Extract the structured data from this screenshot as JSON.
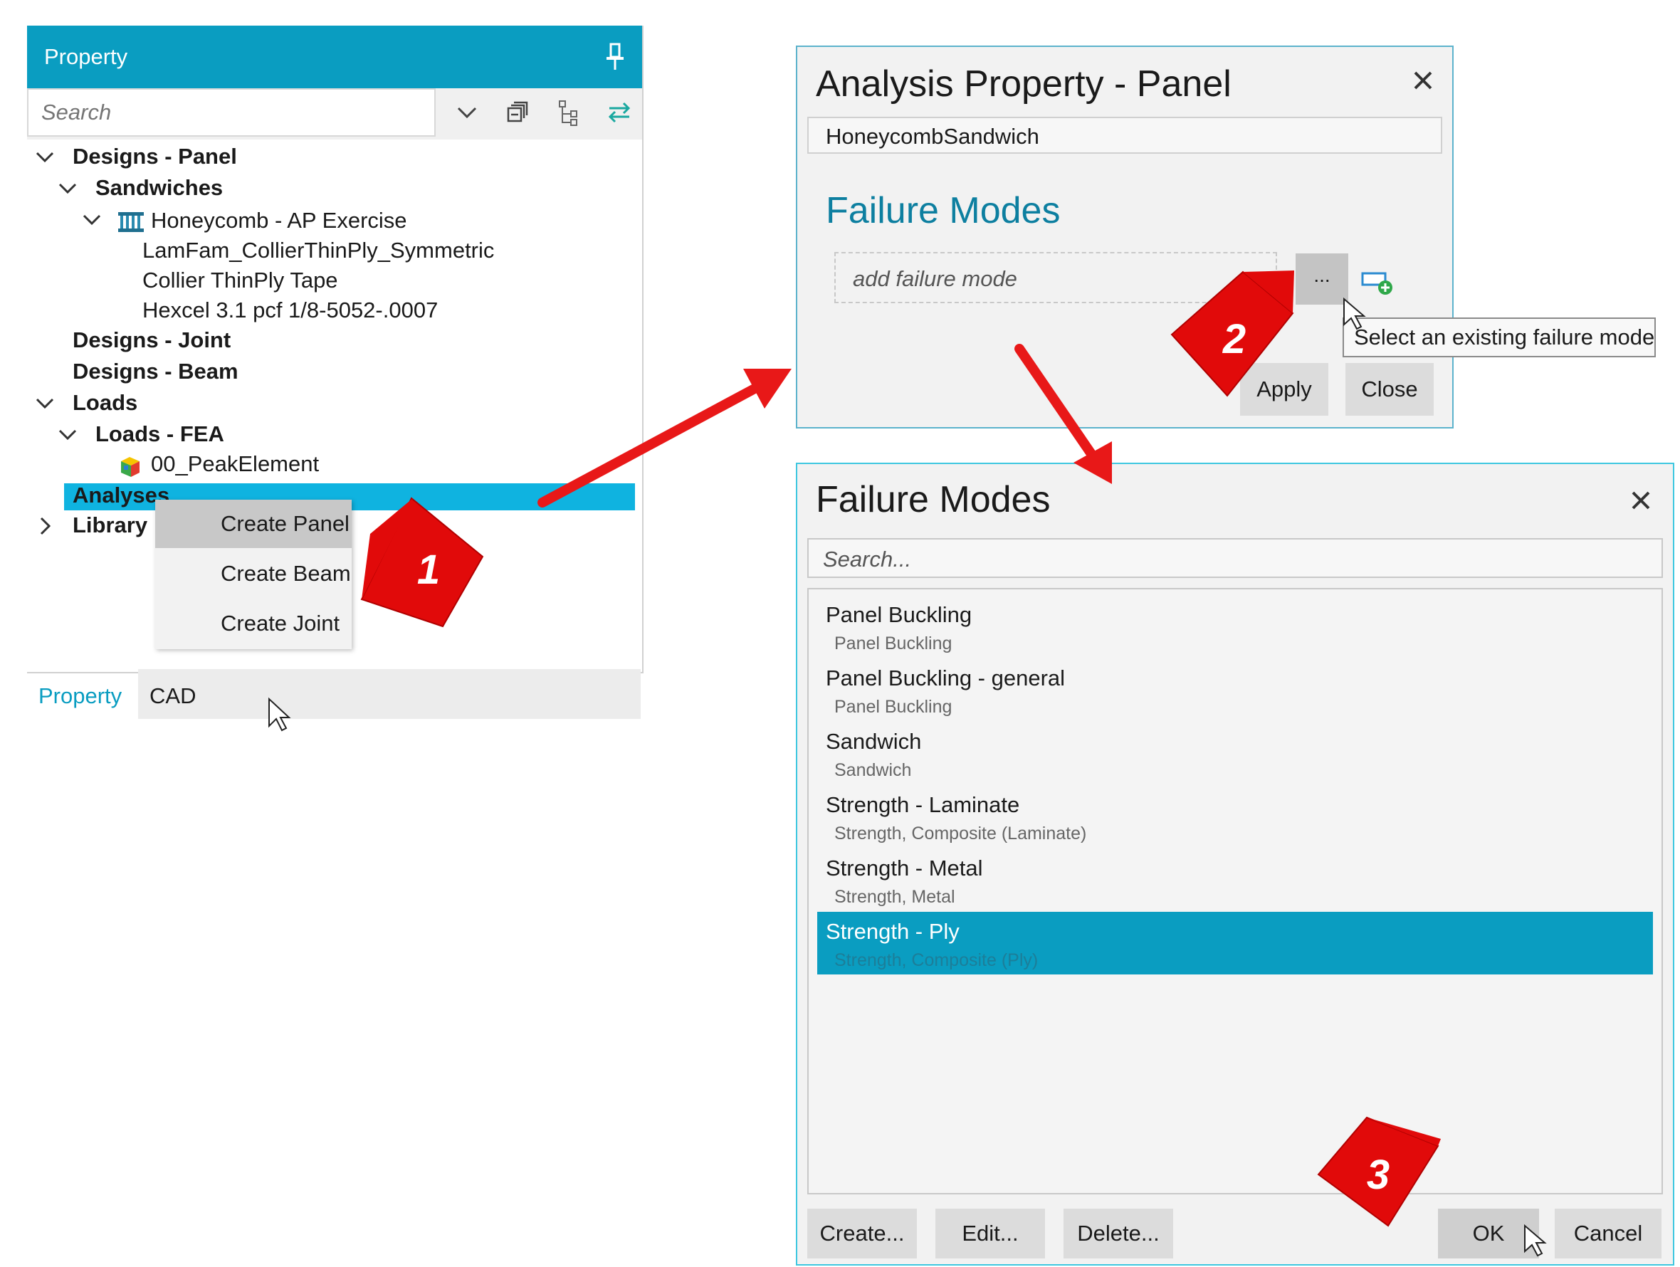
{
  "property_panel": {
    "title": "Property",
    "search_placeholder": "Search",
    "tree": [
      {
        "label": "Designs - Panel"
      },
      {
        "label": "Sandwiches"
      },
      {
        "label": "Honeycomb - AP Exercise"
      },
      {
        "label": "LamFam_CollierThinPly_Symmetric"
      },
      {
        "label": "Collier ThinPly Tape"
      },
      {
        "label": "Hexcel 3.1 pcf 1/8-5052-.0007"
      },
      {
        "label": "Designs - Joint"
      },
      {
        "label": "Designs - Beam"
      },
      {
        "label": "Loads"
      },
      {
        "label": "Loads - FEA"
      },
      {
        "label": "00_PeakElement"
      },
      {
        "label": "Analyses"
      },
      {
        "label": "Library"
      }
    ],
    "context_menu": [
      "Create Panel",
      "Create Beam",
      "Create Joint"
    ],
    "tabs": {
      "property": "Property",
      "cad": "CAD"
    }
  },
  "analysis_dialog": {
    "title": "Analysis Property - Panel",
    "name_value": "HoneycombSandwich",
    "section_heading": "Failure Modes",
    "failure_mode_placeholder": "add failure mode",
    "ellipsis_label": "...",
    "tooltip": "Select an existing failure mode",
    "apply_label": "Apply",
    "close_label": "Close"
  },
  "failure_modes_dialog": {
    "title": "Failure Modes",
    "search_placeholder": "Search...",
    "items": [
      {
        "name": "Panel Buckling",
        "desc": "Panel Buckling"
      },
      {
        "name": "Panel Buckling - general",
        "desc": "Panel Buckling"
      },
      {
        "name": "Sandwich",
        "desc": "Sandwich"
      },
      {
        "name": "Strength - Laminate",
        "desc": "Strength, Composite (Laminate)"
      },
      {
        "name": "Strength - Metal",
        "desc": "Strength, Metal"
      },
      {
        "name": "Strength - Ply",
        "desc": "Strength, Composite (Ply)"
      }
    ],
    "selected_item": "Strength - Ply",
    "buttons": {
      "create": "Create...",
      "edit": "Edit...",
      "delete": "Delete...",
      "ok": "OK",
      "cancel": "Cancel"
    }
  },
  "callouts": [
    "1",
    "2",
    "3"
  ],
  "colors": {
    "accent": "#0a9dc1",
    "selection": "#0fb3e0",
    "callout": "#e10a0a",
    "arrow": "#e81818"
  }
}
